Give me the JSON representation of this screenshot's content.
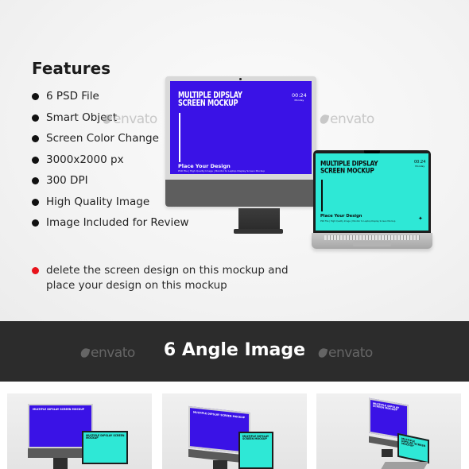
{
  "features": {
    "title": "Features",
    "items": [
      "6 PSD File",
      "Smart Object",
      "Screen Color Change",
      "3000x2000 px",
      "300 DPI",
      "High Quality Image",
      "Image Included for Review"
    ]
  },
  "note": {
    "text": "delete the screen design on this mockup and place your design on this mockup",
    "bullet_color": "#e8131b"
  },
  "mockup_screen": {
    "title_line1": "Multiple Dipslay",
    "title_line2": "Screen Mockup",
    "time": "00:24",
    "day": "Monday",
    "place_label": "Place Your Design",
    "subtitle": "PSD File | High Quality Image | Monitor to Laptop Display Screen Mockup",
    "logo_glyph": "✦"
  },
  "colors": {
    "monitor_screen": "#3a12e6",
    "laptop_screen": "#2ee8d6",
    "banner_bg": "#2c2c2c"
  },
  "watermark": {
    "text": "envato"
  },
  "banner": {
    "title": "6 Angle Image"
  },
  "thumbnails": [
    {
      "label": "Multiple Dipslay Screen Mockup"
    },
    {
      "label": "Multiple Dipslay Screen Mockup"
    },
    {
      "label": "Multiple Dipslay Screen Mockup"
    }
  ]
}
